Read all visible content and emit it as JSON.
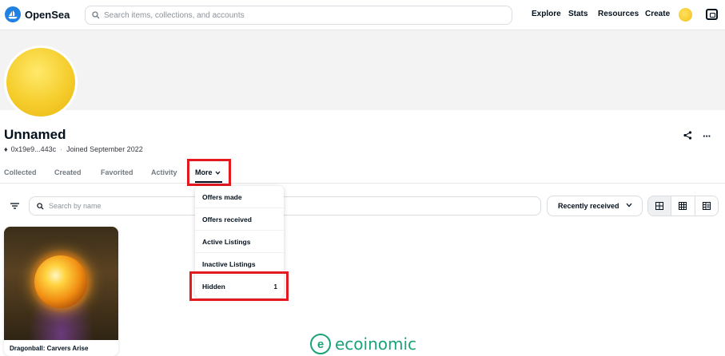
{
  "header": {
    "brand": "OpenSea",
    "search_placeholder": "Search items, collections, and accounts",
    "nav": [
      "Explore",
      "Stats",
      "Resources",
      "Create"
    ]
  },
  "profile": {
    "name": "Unnamed",
    "address": "0x19e9...443c",
    "joined": "Joined September 2022"
  },
  "tabs": {
    "collected": "Collected",
    "created": "Created",
    "favorited": "Favorited",
    "activity": "Activity",
    "more": "More"
  },
  "filters": {
    "search_placeholder": "Search by name",
    "sort_value": "Recently received"
  },
  "dropdown": {
    "items": [
      {
        "label": "Offers made"
      },
      {
        "label": "Offers received"
      },
      {
        "label": "Active Listings"
      },
      {
        "label": "Inactive Listings"
      },
      {
        "label": "Hidden",
        "count": "1"
      }
    ]
  },
  "card": {
    "title": "Dragonball: Carvers Arise"
  },
  "watermark": {
    "text": "ecoinomic",
    "mark": "e"
  },
  "colors": {
    "brand_blue": "#2081e2",
    "highlight_red": "#e3191f",
    "watermark_green": "#1aa37a"
  }
}
